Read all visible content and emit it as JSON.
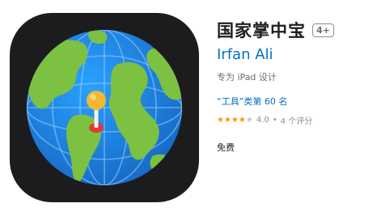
{
  "app": {
    "title": "国家掌中宝",
    "age_rating": "4+",
    "developer": "Irfan Ali",
    "designed_for": "专为 iPad 设计",
    "rank": "“工具”类第 60 名",
    "rating": {
      "stars_filled": 4,
      "stars_total": 5,
      "value": "4.0",
      "separator": "•",
      "count": "4 个评分"
    },
    "price": "免费"
  },
  "colors": {
    "icon_background": "#1c1c1e",
    "ocean": "#1e88e5",
    "land": "#7cc142",
    "link_blue": "#0070c9",
    "star": "#ff9500",
    "pin_head": "#f5b731",
    "pin_base": "#e53935"
  },
  "icons": {
    "app_icon": "globe-with-map-pin-icon"
  }
}
